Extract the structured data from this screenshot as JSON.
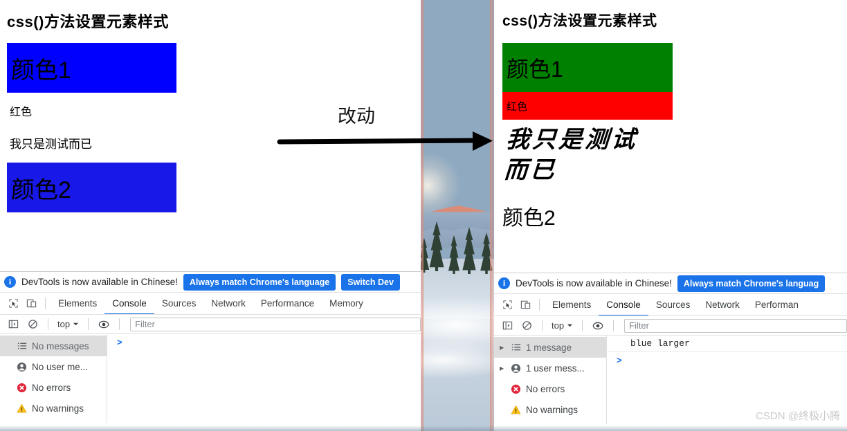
{
  "wallpaper": {
    "description": "mountain-lake-sunrise-wallpaper"
  },
  "arrow": {
    "label": "改动",
    "icon": "right-arrow-icon"
  },
  "watermark": {
    "text": "CSDN @终极小腾"
  },
  "left_window": {
    "page": {
      "title": "css()方法设置元素样式",
      "blocks": [
        {
          "name": "color1",
          "text": "颜色1",
          "bg": "#0000ff",
          "color": "#000000",
          "size": "large"
        },
        {
          "name": "red-label",
          "text": "红色",
          "bg": "transparent",
          "color": "#000000",
          "size": "normal"
        },
        {
          "name": "test-text",
          "text": "我只是测试而已",
          "bg": "transparent",
          "color": "#000000",
          "size": "normal"
        },
        {
          "name": "color2",
          "text": "颜色2",
          "bg": "#1818e8",
          "color": "#000000",
          "size": "large"
        }
      ]
    },
    "devtools": {
      "banner": {
        "icon": "info-icon",
        "message": "DevTools is now available in Chinese!",
        "primary_button": "Always match Chrome's language",
        "secondary_button": "Switch Dev"
      },
      "toolbar_icons": [
        "inspect-element-icon",
        "device-toolbar-icon"
      ],
      "tabs": [
        "Elements",
        "Console",
        "Sources",
        "Network",
        "Performance",
        "Memory"
      ],
      "active_tab": "Console",
      "console_toolbar": {
        "sidebar_toggle_icon": "console-sidebar-icon",
        "clear_icon": "clear-console-icon",
        "context": "top",
        "context_caret": "chevron-down-icon",
        "eye_icon": "live-expression-icon",
        "filter_placeholder": "Filter",
        "filter_value": ""
      },
      "sidebar": [
        {
          "label": "No messages",
          "icon": "list-icon",
          "selected": true,
          "expandable": false
        },
        {
          "label": "No user me...",
          "icon": "user-icon",
          "selected": false,
          "expandable": false
        },
        {
          "label": "No errors",
          "icon": "error-icon",
          "selected": false,
          "expandable": false
        },
        {
          "label": "No warnings",
          "icon": "warning-icon",
          "selected": false,
          "expandable": false
        }
      ],
      "console_logs": [],
      "prompt": ">"
    }
  },
  "right_window": {
    "page": {
      "title": "css()方法设置元素样式",
      "blocks": [
        {
          "name": "color1",
          "text": "颜色1",
          "bg": "#008000",
          "color": "#000000",
          "size": "large"
        },
        {
          "name": "red-label",
          "text": "红色",
          "bg": "#ff0000",
          "color": "#000000",
          "size": "normal"
        },
        {
          "name": "test-text",
          "text": "我只是测试而已",
          "bg": "transparent",
          "color": "#000000",
          "size": "calligraphy"
        },
        {
          "name": "color2",
          "text": "颜色2",
          "bg": "transparent",
          "color": "#000000",
          "size": "large"
        }
      ]
    },
    "devtools": {
      "banner": {
        "icon": "info-icon",
        "message": "DevTools is now available in Chinese!",
        "primary_button": "Always match Chrome's languag"
      },
      "toolbar_icons": [
        "inspect-element-icon",
        "device-toolbar-icon"
      ],
      "tabs": [
        "Elements",
        "Console",
        "Sources",
        "Network",
        "Performan"
      ],
      "active_tab": "Console",
      "console_toolbar": {
        "sidebar_toggle_icon": "console-sidebar-icon",
        "clear_icon": "clear-console-icon",
        "context": "top",
        "context_caret": "chevron-down-icon",
        "eye_icon": "live-expression-icon",
        "filter_placeholder": "Filter",
        "filter_value": ""
      },
      "sidebar": [
        {
          "label": "1 message",
          "icon": "list-icon",
          "selected": true,
          "expandable": true
        },
        {
          "label": "1 user mess...",
          "icon": "user-icon",
          "selected": false,
          "expandable": true
        },
        {
          "label": "No errors",
          "icon": "error-icon",
          "selected": false,
          "expandable": false
        },
        {
          "label": "No warnings",
          "icon": "warning-icon",
          "selected": false,
          "expandable": false
        }
      ],
      "console_logs": [
        "blue larger"
      ],
      "prompt": ">"
    }
  }
}
